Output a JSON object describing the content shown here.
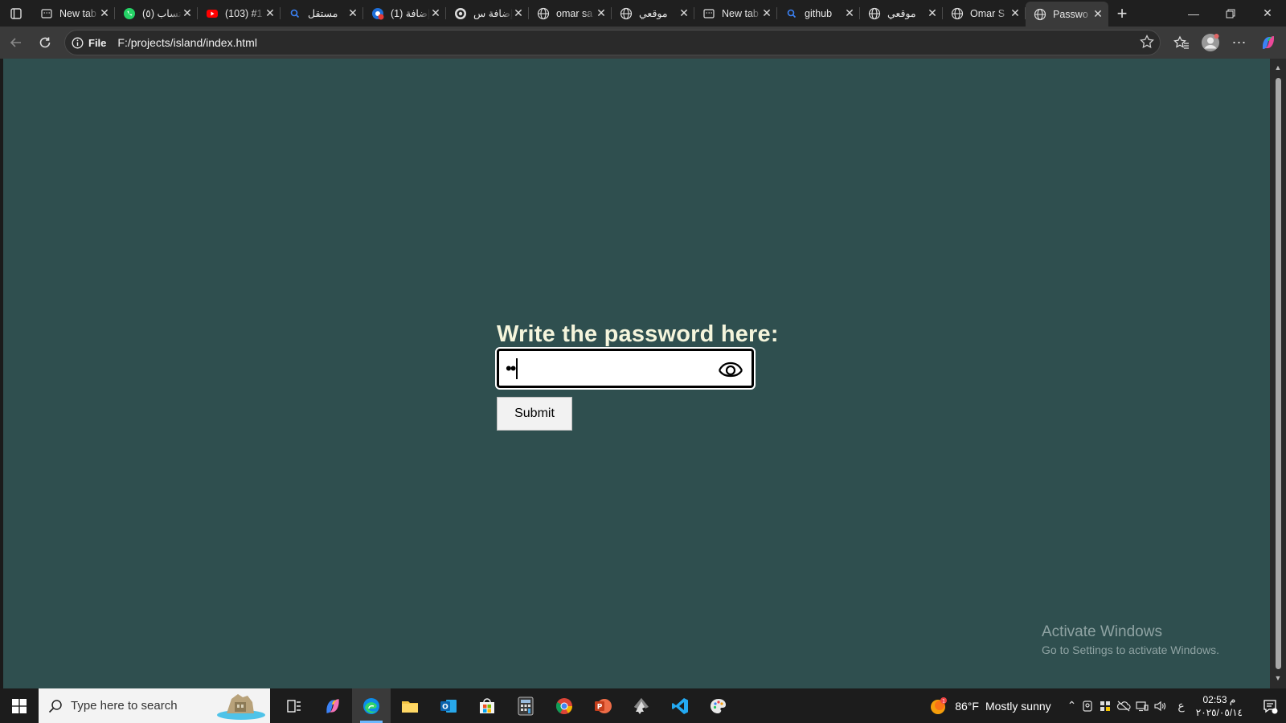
{
  "browser": {
    "tabs": [
      {
        "title": "New tab",
        "favicon": "newtab-icon",
        "active": false
      },
      {
        "title": "(٥) واتساب",
        "favicon": "whatsapp-icon",
        "active": false
      },
      {
        "title": "(103) #1",
        "favicon": "youtube-icon",
        "active": false
      },
      {
        "title": "مستقل",
        "favicon": "search-icon",
        "active": false
      },
      {
        "title": "(1) إضافة",
        "favicon": "notification-badge-icon",
        "active": false
      },
      {
        "title": "إضافة س",
        "favicon": "target-icon",
        "active": false
      },
      {
        "title": "omar sa",
        "favicon": "globe-icon",
        "active": false
      },
      {
        "title": "موقعي",
        "favicon": "globe-icon",
        "active": false
      },
      {
        "title": "New tab",
        "favicon": "newtab-icon",
        "active": false
      },
      {
        "title": "github",
        "favicon": "search-icon",
        "active": false
      },
      {
        "title": "موقعي",
        "favicon": "globe-icon",
        "active": false
      },
      {
        "title": "Omar S",
        "favicon": "globe-icon",
        "active": false
      },
      {
        "title": "Passwo",
        "favicon": "globe-icon",
        "active": true
      }
    ],
    "address": {
      "site_label": "File",
      "url": "F:/projects/island/index.html"
    }
  },
  "page": {
    "background": "#2f4f4f",
    "heading": "Write the password here:",
    "password_masked": "••",
    "submit_label": "Submit",
    "watermark_title": "Activate Windows",
    "watermark_subtitle": "Go to Settings to activate Windows."
  },
  "taskbar": {
    "search_placeholder": "Type here to search",
    "apps": [
      "task-view-icon",
      "copilot-icon",
      "edge-icon",
      "file-explorer-icon",
      "outlook-icon",
      "store-icon",
      "calculator-icon",
      "chrome-icon",
      "powerpoint-icon",
      "inkscape-icon",
      "vscode-icon",
      "paint-icon"
    ],
    "weather": {
      "temp": "86°F",
      "condition": "Mostly sunny"
    },
    "input_lang": "ع",
    "time": "02:53 م",
    "date": "٢٠٢٥/٠٥/١٤"
  }
}
